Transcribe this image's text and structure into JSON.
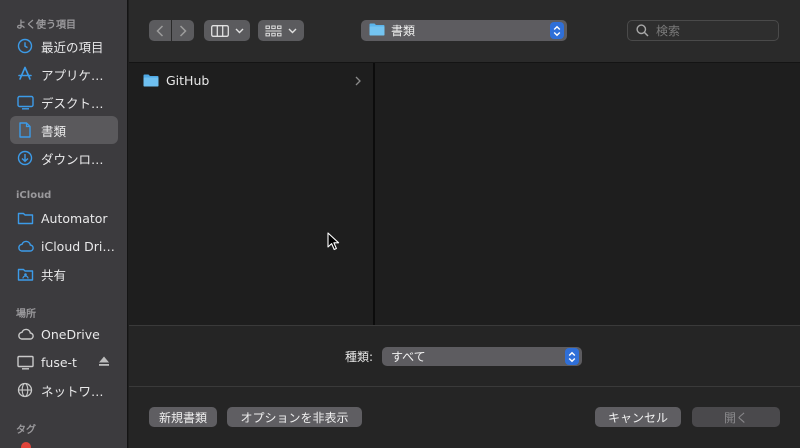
{
  "sidebar": {
    "sections": [
      {
        "title": "よく使う項目",
        "items": [
          {
            "label": "最近の項目",
            "icon": "clock-icon"
          },
          {
            "label": "アプリケ…",
            "icon": "applications-icon"
          },
          {
            "label": "デスクト…",
            "icon": "desktop-icon"
          },
          {
            "label": "書類",
            "icon": "document-icon",
            "selected": true
          },
          {
            "label": "ダウンロ…",
            "icon": "download-icon"
          }
        ]
      },
      {
        "title": "iCloud",
        "items": [
          {
            "label": "Automator",
            "icon": "folder-icon"
          },
          {
            "label": "iCloud Dri…",
            "icon": "cloud-icon"
          },
          {
            "label": "共有",
            "icon": "shared-folder-icon"
          }
        ]
      },
      {
        "title": "場所",
        "items": [
          {
            "label": "OneDrive",
            "icon": "cloud-icon"
          },
          {
            "label": "fuse-t",
            "icon": "display-icon"
          },
          {
            "label": "ネットワ…",
            "icon": "network-icon"
          }
        ]
      },
      {
        "title": "タグ",
        "items": []
      }
    ]
  },
  "toolbar": {
    "location": "書類",
    "search_placeholder": "検索"
  },
  "browser": {
    "items": [
      {
        "name": "GitHub",
        "type": "folder"
      }
    ]
  },
  "format": {
    "label": "種類:",
    "value": "すべて"
  },
  "actions": {
    "new_folder": "新規書類",
    "hide_options": "オプションを非表示",
    "cancel": "キャンセル",
    "open": "開く"
  },
  "colors": {
    "accent": "#2f6fd8",
    "folder": "#5bb5ec"
  }
}
